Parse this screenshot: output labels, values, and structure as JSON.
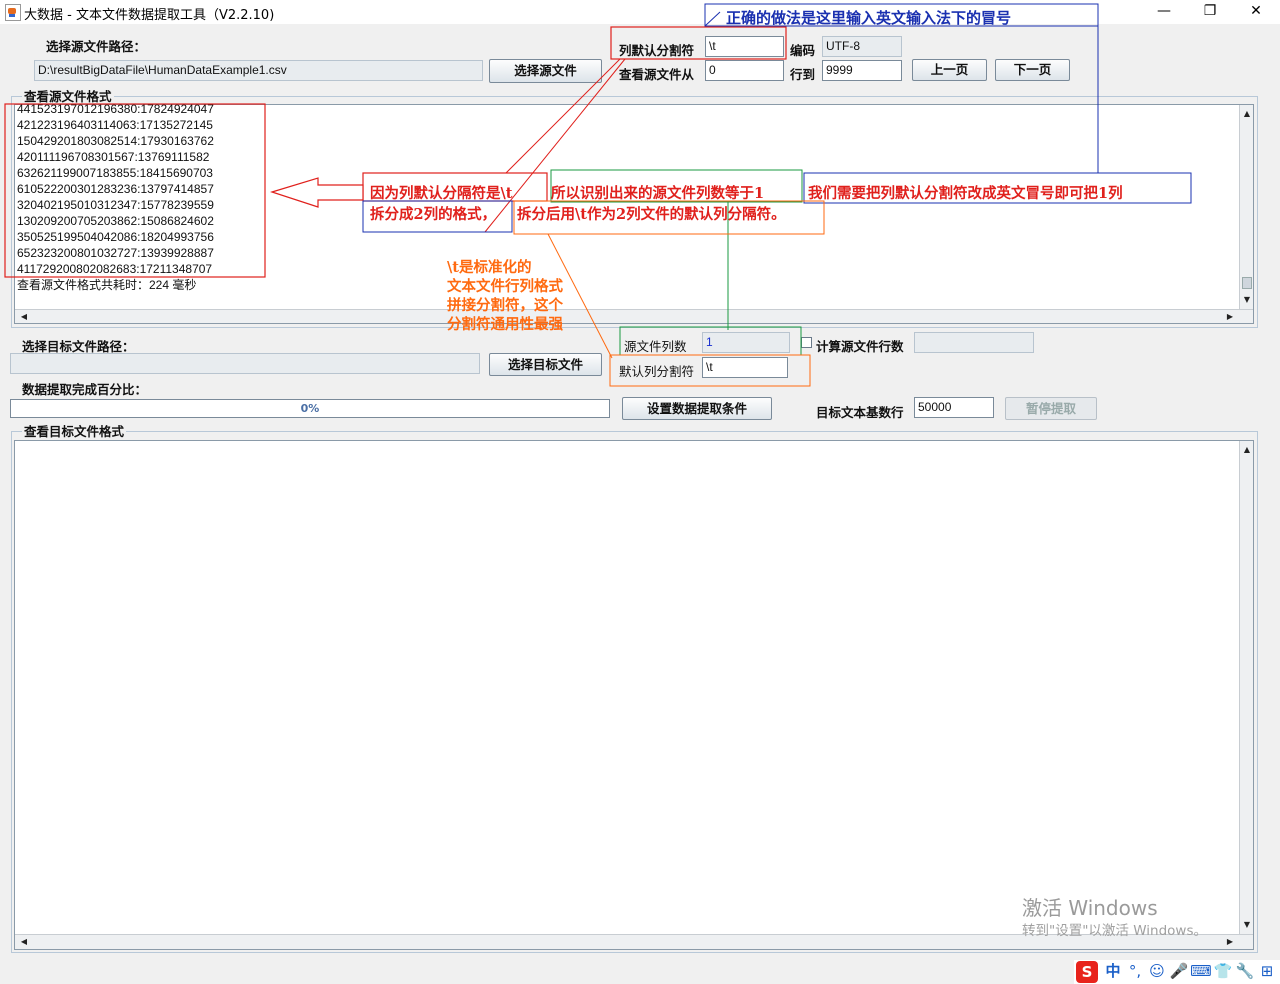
{
  "window": {
    "title": "大数据 - 文本文件数据提取工具（V2.2.10)",
    "controls": {
      "minimize": "—",
      "maximize": "❐",
      "close": "✕"
    }
  },
  "source": {
    "path_label": "选择源文件路径：",
    "path_value": "D:\\resultBigDataFile\\HumanDataExample1.csv",
    "choose_button": "选择源文件",
    "delimiter_label": "列默认分割符",
    "delimiter_value": "\\t",
    "encoding_label": "编码",
    "encoding_value": "UTF-8",
    "view_from_label": "查看源文件从",
    "view_from_value": "0",
    "row_to_label": "行到",
    "row_to_value": "9999",
    "prev_button": "上一页",
    "next_button": "下一页",
    "format_group_title": "查看源文件格式",
    "lines": [
      "441523197012196380:17824924047",
      "421223196403114063:17135272145",
      "150429201803082514:17930163762",
      "420111196708301567:13769111582",
      "632621199007183855:18415690703",
      "610522200301283236:13797414857",
      "320402195010312347:15778239559",
      "130209200705203862:15086824602",
      "350525199504042086:18204993756",
      "652323200801032727:13939928887",
      "411729200802082683:17211348707"
    ],
    "timing_text": "查看源文件格式共耗时：224 毫秒"
  },
  "target": {
    "path_label": "选择目标文件路径：",
    "path_value": "",
    "choose_button": "选择目标文件",
    "col_count_label": "源文件列数",
    "col_count_value": "1",
    "count_rows_label": "计算源文件行数",
    "count_rows_value": "",
    "default_delim_label": "默认列分割符",
    "default_delim_value": "\\t",
    "progress_label": "数据提取完成百分比：",
    "progress_text": "0%",
    "progress_fraction": 0,
    "set_conditions_button": "设置数据提取条件",
    "base_rows_label": "目标文本基数行",
    "base_rows_value": "50000",
    "pause_button": "暂停提取",
    "format_group_title": "查看目标文件格式"
  },
  "annotations": {
    "top_note": "正确的做法是这里输入英文输入法下的冒号",
    "note_a": "因为列默认分隔符是\\t",
    "note_b": "所以识别出来的源文件列数等于1",
    "note_c": "我们需要把列默认分割符改成英文冒号即可把1列",
    "note_d": "拆分成2列的格式，",
    "note_e": "拆分后用\\t作为2列文件的默认列分隔符。",
    "orange_note": [
      "\\t是标准化的",
      "文本文件行列格式",
      "拼接分割符，这个",
      "分割符通用性最强"
    ]
  },
  "watermark": {
    "line1": "激活 Windows",
    "line2": "转到\"设置\"以激活 Windows。"
  },
  "taskbar": {
    "items": [
      "中",
      "°,",
      "☺",
      "🎤",
      "⌨",
      "👕",
      "🔧",
      "⊞"
    ]
  },
  "colors": {
    "red": "#e0201c",
    "blue": "#1a30b0",
    "green": "#1a9a40",
    "orange": "#ff6a10"
  }
}
